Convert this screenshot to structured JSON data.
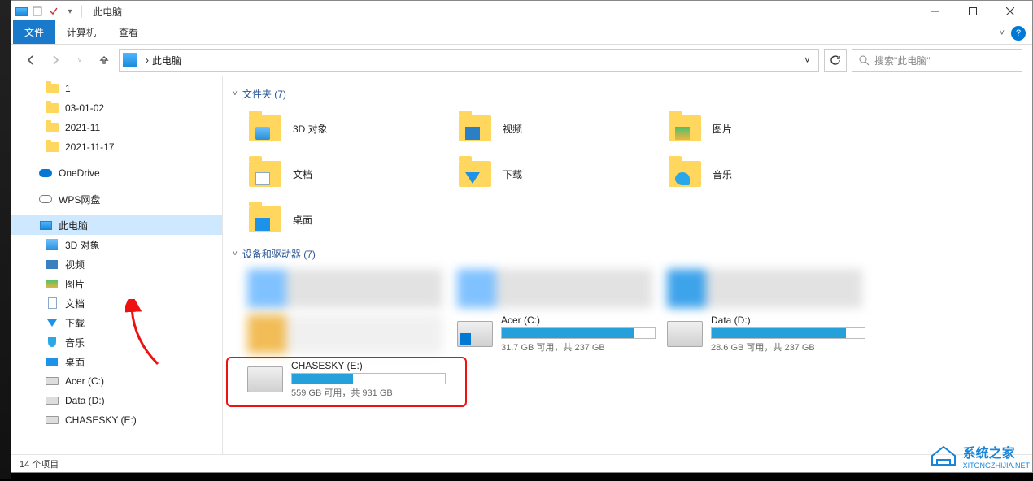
{
  "window": {
    "title": "此电脑",
    "ribbon": {
      "tabs": [
        "文件",
        "计算机",
        "查看"
      ],
      "active": 0
    }
  },
  "address": {
    "location": "此电脑",
    "separator": "›"
  },
  "search": {
    "placeholder": "搜索\"此电脑\""
  },
  "sidebar": {
    "quick": [
      "1",
      "03-01-02",
      "2021-11",
      "2021-11-17"
    ],
    "clouds": [
      "OneDrive",
      "WPS网盘"
    ],
    "pc_label": "此电脑",
    "pc_children": [
      "3D 对象",
      "视频",
      "图片",
      "文档",
      "下载",
      "音乐",
      "桌面",
      "Acer (C:)",
      "Data (D:)",
      "CHASESKY (E:)"
    ]
  },
  "sections": {
    "folders": {
      "title": "文件夹",
      "count": 7
    },
    "devices": {
      "title": "设备和驱动器",
      "count": 7
    }
  },
  "folders": [
    {
      "label": "3D 对象",
      "ov": "ov-3d"
    },
    {
      "label": "视频",
      "ov": "ov-video"
    },
    {
      "label": "图片",
      "ov": "ov-pic"
    },
    {
      "label": "文档",
      "ov": "ov-doc"
    },
    {
      "label": "下载",
      "ov": "ov-down"
    },
    {
      "label": "音乐",
      "ov": "ov-music"
    },
    {
      "label": "桌面",
      "ov": "ov-desk"
    }
  ],
  "drives": {
    "acer": {
      "name": "Acer (C:)",
      "sub": "31.7 GB 可用，共 237 GB",
      "pct": 86
    },
    "data": {
      "name": "Data (D:)",
      "sub": "28.6 GB 可用，共 237 GB",
      "pct": 88
    },
    "chase": {
      "name": "CHASESKY (E:)",
      "sub": "559 GB 可用，共 931 GB",
      "pct": 40
    }
  },
  "statusbar": {
    "count_text": "14 个项目"
  },
  "logo": {
    "brand": "系统之家",
    "url": "XITONGZHIJIA.NET"
  }
}
